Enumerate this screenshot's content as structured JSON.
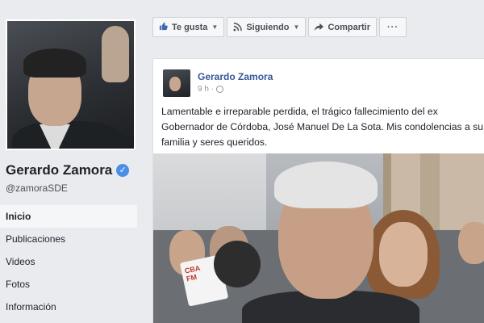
{
  "profile": {
    "name": "Gerardo Zamora",
    "handle": "@zamoraSDE",
    "verified": true,
    "verified_icon": "verified-check-icon"
  },
  "nav": {
    "items": [
      {
        "label": "Inicio",
        "active": true
      },
      {
        "label": "Publicaciones",
        "active": false
      },
      {
        "label": "Videos",
        "active": false
      },
      {
        "label": "Fotos",
        "active": false
      },
      {
        "label": "Información",
        "active": false
      }
    ]
  },
  "actions": {
    "like_label": "Te gusta",
    "following_label": "Siguiendo",
    "share_label": "Compartir",
    "more_label": "···",
    "icons": [
      "thumbs-up-icon",
      "rss-icon",
      "share-arrow-icon",
      "more-icon"
    ]
  },
  "post": {
    "author": "Gerardo Zamora",
    "time": "9 h ·",
    "audience_icon": "globe-icon",
    "text": "Lamentable e irreparable perdida, el trágico fallecimiento del ex Gobernador de Córdoba, José Manuel De La Sota. Mis condolencias a su familia y seres queridos.",
    "photo_mic_label": "CBA\nFM"
  },
  "colors": {
    "background": "#e9ebee",
    "link": "#365899",
    "accent": "#4267b2"
  }
}
